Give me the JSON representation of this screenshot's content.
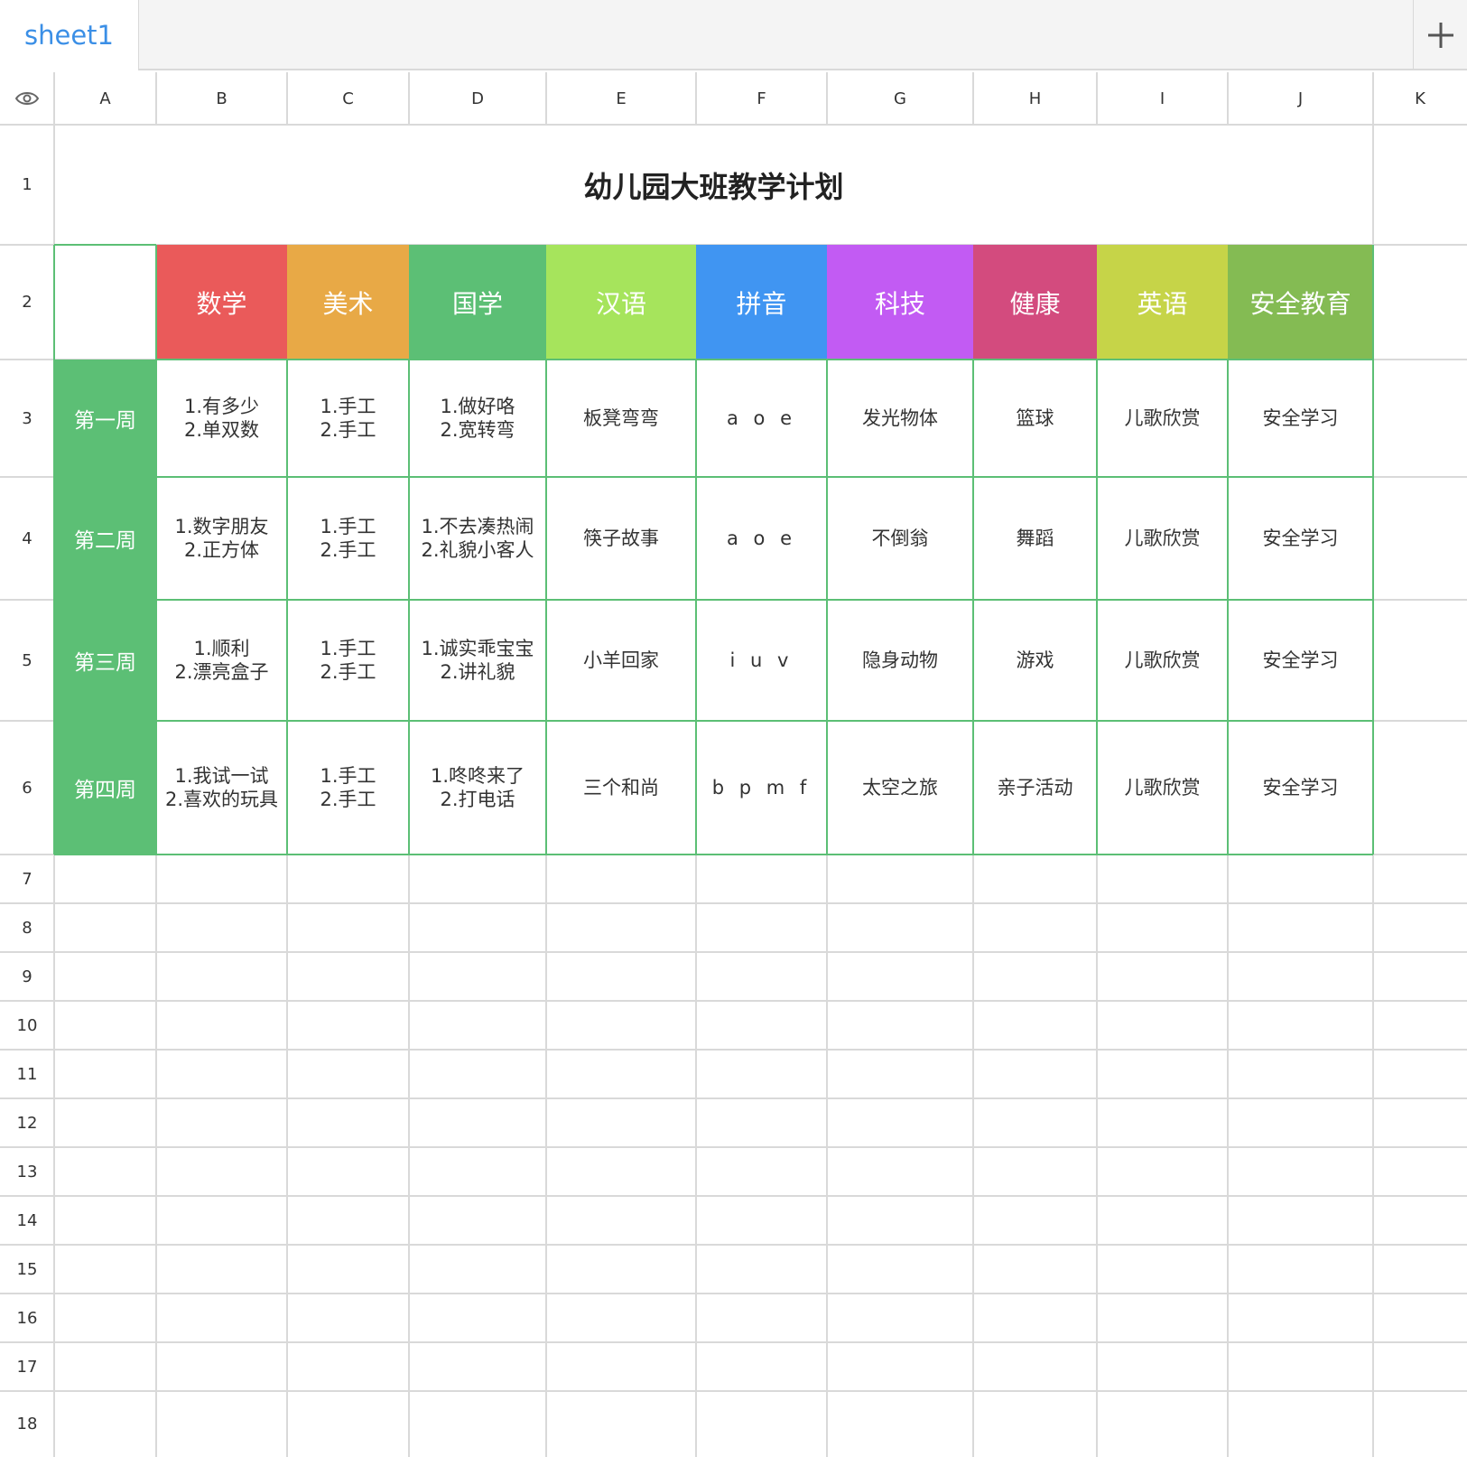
{
  "tabs": [
    {
      "label": "sheet1",
      "active": true
    }
  ],
  "add_sheet": {
    "icon": "plus-icon"
  },
  "corner": {
    "icon": "eye-icon"
  },
  "columns": [
    "A",
    "B",
    "C",
    "D",
    "E",
    "F",
    "G",
    "H",
    "I",
    "J",
    "K"
  ],
  "rows": [
    "1",
    "2",
    "3",
    "4",
    "5",
    "6",
    "7",
    "8",
    "9",
    "10",
    "11",
    "12",
    "13",
    "14",
    "15",
    "16",
    "17",
    "18"
  ],
  "colors": {
    "accent": "#3b8fe6",
    "gridline": "#d9d9d9",
    "table_border": "#5cbf75",
    "week_bg": "#5cbf75"
  },
  "sheet": {
    "title": "幼儿园大班教学计划",
    "subjects": [
      {
        "label": "数学",
        "color": "#ea5a5a"
      },
      {
        "label": "美术",
        "color": "#e8a946"
      },
      {
        "label": "国学",
        "color": "#5cbf75"
      },
      {
        "label": "汉语",
        "color": "#a6e45c"
      },
      {
        "label": "拼音",
        "color": "#4095f2"
      },
      {
        "label": "科技",
        "color": "#c25bf3"
      },
      {
        "label": "健康",
        "color": "#d34b7e"
      },
      {
        "label": "英语",
        "color": "#c6d448"
      },
      {
        "label": "安全教育",
        "color": "#84bb53"
      }
    ],
    "weeks": [
      {
        "label": "第一周",
        "cells": [
          "1.有多少\n2.单双数",
          "1.手工\n2.手工",
          "1.做好咯\n2.宽转弯",
          "板凳弯弯",
          "a o e",
          "发光物体",
          "篮球",
          "儿歌欣赏",
          "安全学习"
        ]
      },
      {
        "label": "第二周",
        "cells": [
          "1.数字朋友\n2.正方体",
          "1.手工\n2.手工",
          "1.不去凑热闹\n2.礼貌小客人",
          "筷子故事",
          "a o e",
          "不倒翁",
          "舞蹈",
          "儿歌欣赏",
          "安全学习"
        ]
      },
      {
        "label": "第三周",
        "cells": [
          "1.顺利\n2.漂亮盒子",
          "1.手工\n2.手工",
          "1.诚实乖宝宝\n2.讲礼貌",
          "小羊回家",
          "i u v",
          "隐身动物",
          "游戏",
          "儿歌欣赏",
          "安全学习"
        ]
      },
      {
        "label": "第四周",
        "cells": [
          "1.我试一试\n2.喜欢的玩具",
          "1.手工\n2.手工",
          "1.咚咚来了\n2.打电话",
          "三个和尚",
          "b p m f",
          "太空之旅",
          "亲子活动",
          "儿歌欣赏",
          "安全学习"
        ]
      }
    ]
  }
}
